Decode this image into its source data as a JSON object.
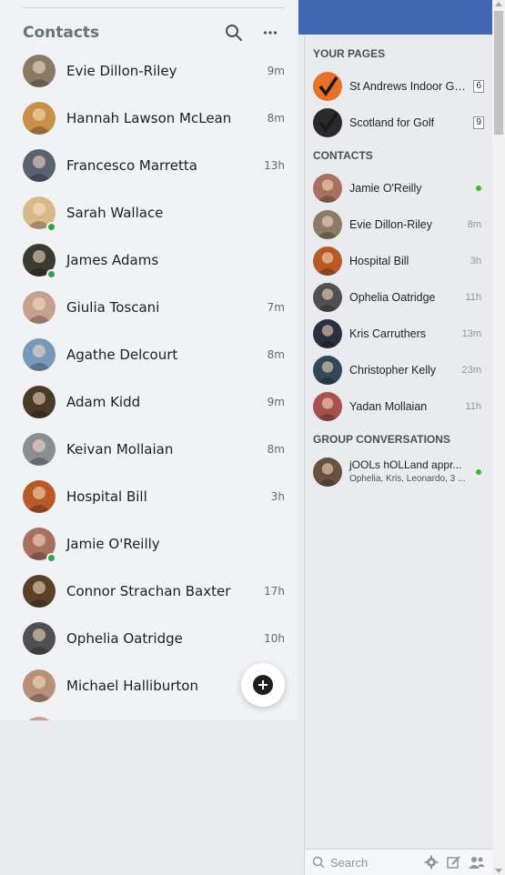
{
  "left_panel": {
    "title": "Contacts",
    "search_icon": "search-icon",
    "more_icon": "more-icon",
    "new_message_icon": "plus-circle-icon",
    "contacts": [
      {
        "name": "Evie Dillon-Riley",
        "time": "9m",
        "online": false,
        "color": "#8a7a66"
      },
      {
        "name": "Hannah Lawson McLean",
        "time": "8m",
        "online": false,
        "color": "#c89048"
      },
      {
        "name": "Francesco Marretta",
        "time": "13h",
        "online": false,
        "color": "#5a6170"
      },
      {
        "name": "Sarah Wallace",
        "time": "",
        "online": true,
        "color": "#d8b98a"
      },
      {
        "name": "James Adams",
        "time": "",
        "online": true,
        "color": "#3a3a30"
      },
      {
        "name": "Giulia Toscani",
        "time": "7m",
        "online": false,
        "color": "#c8a090"
      },
      {
        "name": "Agathe Delcourt",
        "time": "8m",
        "online": false,
        "color": "#7898b8"
      },
      {
        "name": "Adam Kidd",
        "time": "9m",
        "online": false,
        "color": "#4a3a28"
      },
      {
        "name": "Keivan Mollaian",
        "time": "8m",
        "online": false,
        "color": "#8a8e94"
      },
      {
        "name": "Hospital Bill",
        "time": "3h",
        "online": false,
        "color": "#b85a28"
      },
      {
        "name": "Jamie O'Reilly",
        "time": "",
        "online": true,
        "color": "#a87060"
      },
      {
        "name": "Connor Strachan Baxter",
        "time": "17h",
        "online": false,
        "color": "#5a4028"
      },
      {
        "name": "Ophelia Oatridge",
        "time": "10h",
        "online": false,
        "color": "#505050"
      },
      {
        "name": "Michael Halliburton",
        "time": "",
        "online": false,
        "color": "#b89078"
      },
      {
        "name": "",
        "time": "",
        "online": false,
        "color": "#c8a088"
      }
    ]
  },
  "right_panel": {
    "sections": {
      "your_pages": "YOUR PAGES",
      "contacts": "CONTACTS",
      "groups": "GROUP CONVERSATIONS"
    },
    "pages": [
      {
        "name": "St Andrews Indoor Go...",
        "badge": "6",
        "color": "#e8702a"
      },
      {
        "name": "Scotland for Golf",
        "badge": "9",
        "color": "#2a2a2a"
      }
    ],
    "contacts": [
      {
        "name": "Jamie O'Reilly",
        "time": "",
        "online": true,
        "color": "#a87060"
      },
      {
        "name": "Evie Dillon-Riley",
        "time": "8m",
        "online": false,
        "color": "#8a7a66"
      },
      {
        "name": "Hospital Bill",
        "time": "3h",
        "online": false,
        "color": "#b85a28"
      },
      {
        "name": "Ophelia Oatridge",
        "time": "11h",
        "online": false,
        "color": "#505050"
      },
      {
        "name": "Kris Carruthers",
        "time": "13m",
        "online": false,
        "color": "#2a3040"
      },
      {
        "name": "Christopher Kelly",
        "time": "23m",
        "online": false,
        "color": "#304858"
      },
      {
        "name": "Yadan Mollaian",
        "time": "11h",
        "online": false,
        "color": "#a85050"
      }
    ],
    "groups": [
      {
        "name": "jOOLs hOLLand appr...",
        "members": "Ophelia, Kris, Leonardo, 3 ...",
        "online": true,
        "color": "#6a5040"
      }
    ],
    "footer": {
      "search_placeholder": "Search",
      "settings_icon": "gear-icon",
      "compose_icon": "compose-icon",
      "group_icon": "group-icon"
    }
  },
  "colors": {
    "accent": "#4267b2",
    "online": "#31a24c"
  }
}
